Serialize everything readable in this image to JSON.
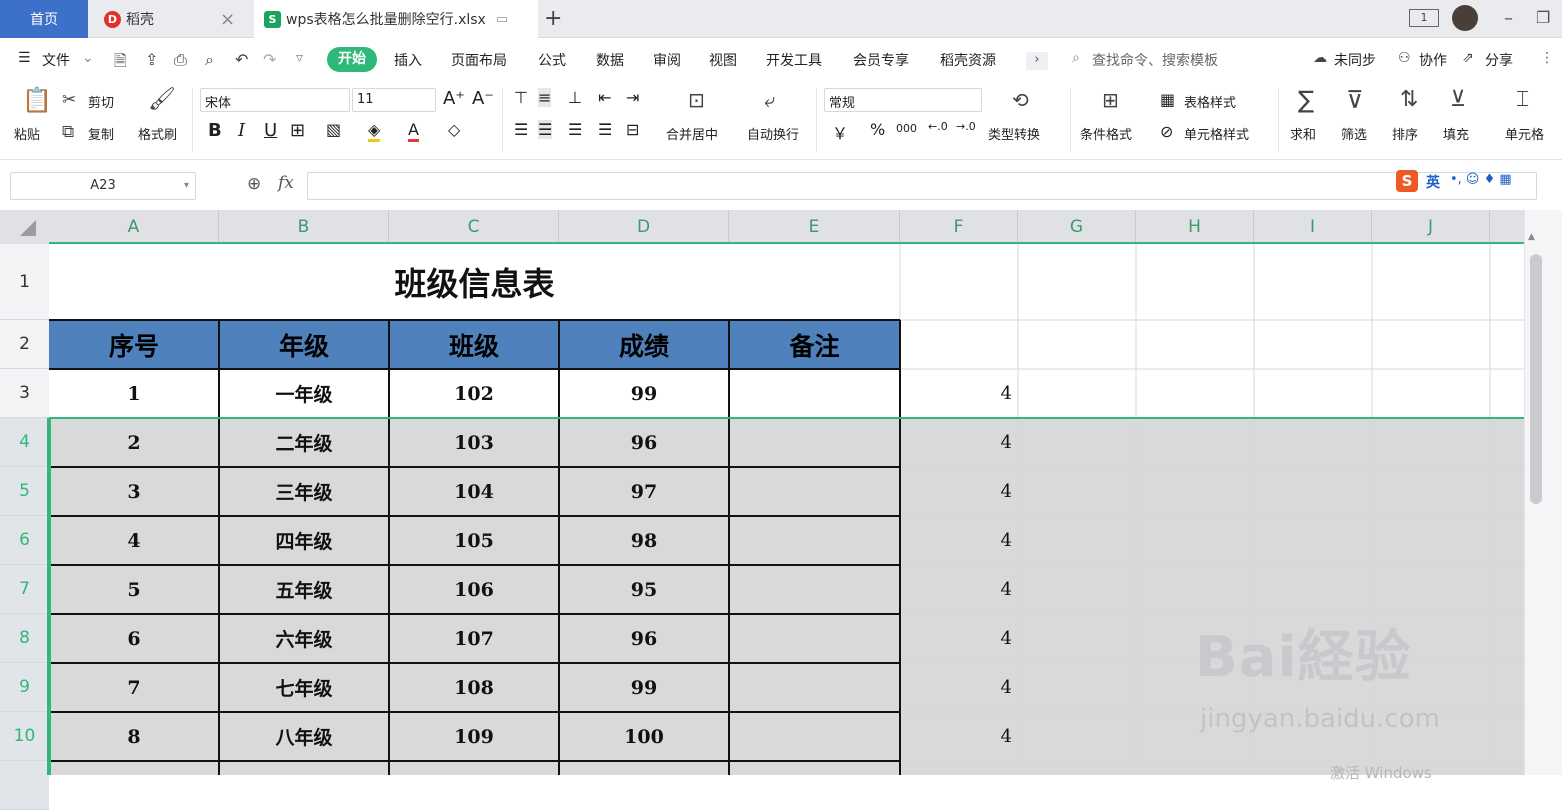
{
  "tabs": {
    "home": "首页",
    "daoke": "稻壳",
    "file": "wps表格怎么批量删除空行.xlsx",
    "close_glyph": "×",
    "add_glyph": "+"
  },
  "window_controls": {
    "page_indicator": "1",
    "minimize": "–",
    "restore": "❐"
  },
  "menu": {
    "file": "文件",
    "items": [
      "开始",
      "插入",
      "页面布局",
      "公式",
      "数据",
      "审阅",
      "视图",
      "开发工具",
      "会员专享",
      "稻壳资源"
    ],
    "more": "›",
    "search_placeholder": "查找命令、搜索模板",
    "sync": "未同步",
    "collab": "协作",
    "share": "分享"
  },
  "ribbon": {
    "paste": "粘贴",
    "cut": "剪切",
    "copy": "复制",
    "format_painter": "格式刷",
    "font_name": "宋体",
    "font_size": "11",
    "bold": "B",
    "italic": "I",
    "underline": "U",
    "merge": "合并居中",
    "wrap": "自动换行",
    "number_format": "常规",
    "currency": "￥",
    "percent": "%",
    "thousands": "000",
    "type_convert": "类型转换",
    "cond_format": "条件格式",
    "table_style": "表格样式",
    "cell_style": "单元格样式",
    "sum": "求和",
    "filter": "筛选",
    "sort": "排序",
    "fill": "填充",
    "cell": "单元格"
  },
  "formula_bar": {
    "cell_ref": "A23",
    "fx": "fx",
    "formula": ""
  },
  "ime": {
    "label": "英"
  },
  "columns": [
    "A",
    "B",
    "C",
    "D",
    "E",
    "F",
    "G",
    "H",
    "I",
    "J"
  ],
  "rows": [
    "1",
    "2",
    "3",
    "4",
    "5",
    "6",
    "7",
    "8",
    "9",
    "10"
  ],
  "sheet": {
    "title": "班级信息表",
    "headers": [
      "序号",
      "年级",
      "班级",
      "成绩",
      "备注"
    ],
    "data": [
      [
        "1",
        "一年级",
        "102",
        "99",
        ""
      ],
      [
        "2",
        "二年级",
        "103",
        "96",
        ""
      ],
      [
        "3",
        "三年级",
        "104",
        "97",
        ""
      ],
      [
        "4",
        "四年级",
        "105",
        "98",
        ""
      ],
      [
        "5",
        "五年级",
        "106",
        "95",
        ""
      ],
      [
        "6",
        "六年级",
        "107",
        "96",
        ""
      ],
      [
        "7",
        "七年级",
        "108",
        "99",
        ""
      ],
      [
        "8",
        "八年级",
        "109",
        "100",
        ""
      ]
    ],
    "f_values": [
      "4",
      "4",
      "4",
      "4",
      "4",
      "4",
      "4",
      "4"
    ]
  },
  "watermark": {
    "brand": "Bai経验",
    "url": "jingyan.baidu.com",
    "windows": "激活 Windows"
  },
  "colors": {
    "accent_green": "#2fb87a",
    "header_blue": "#4f81bd",
    "selection_gray": "#d9d9d9",
    "home_tab": "#3c70c9"
  }
}
